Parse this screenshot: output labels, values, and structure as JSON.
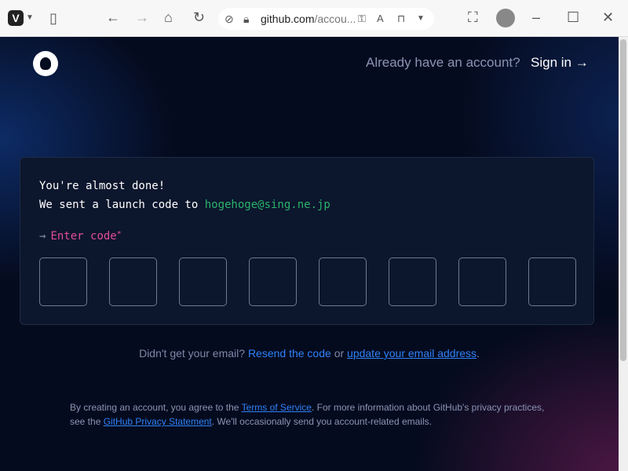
{
  "browser": {
    "url_host": "github.com",
    "url_path": "/accou..."
  },
  "header": {
    "already": "Already have an account?",
    "signin": "Sign in →"
  },
  "card": {
    "line1": "You're almost done!",
    "line2_prefix": "We sent a launch code to ",
    "email": "hogehoge@sing.ne.jp",
    "arrow": "→",
    "enter_label": "Enter code",
    "required": "*",
    "code_boxes": 8
  },
  "resend": {
    "prefix": "Didn't get your email?",
    "resend_link": "Resend the code",
    "or": "or",
    "update_link": "update your email address",
    "suffix": "."
  },
  "legal": {
    "p1": "By creating an account, you agree to the ",
    "terms": "Terms of Service",
    "p2": ". For more information about GitHub's privacy practices, see the ",
    "privacy": "GitHub Privacy Statement",
    "p3": ". We'll occasionally send you account-related emails."
  }
}
